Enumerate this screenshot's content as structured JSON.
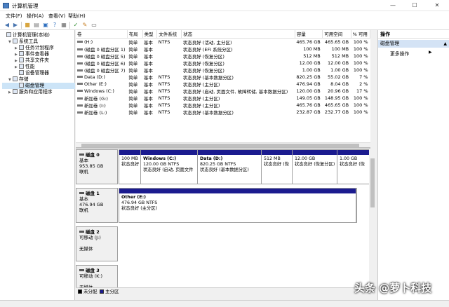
{
  "window": {
    "title": "计算机管理",
    "buttons": {
      "minimize": "—",
      "maximize": "☐",
      "close": "✕"
    }
  },
  "menu": [
    "文件(F)",
    "操作(A)",
    "查看(V)",
    "帮助(H)"
  ],
  "toolbar_icons": [
    "back-arrow-icon",
    "forward-arrow-icon",
    "up-folder-icon",
    "show-tree-icon",
    "properties-icon",
    "help-icon",
    "list-icon",
    "check-icon",
    "export-icon",
    "new-window-icon"
  ],
  "tree": [
    {
      "label": "计算机管理(本地)",
      "depth": 0,
      "expander": "",
      "icon": "computer-icon"
    },
    {
      "label": "系统工具",
      "depth": 1,
      "expander": "▼",
      "icon": "tools-icon"
    },
    {
      "label": "任务计划程序",
      "depth": 2,
      "expander": "▶",
      "icon": "clock-icon"
    },
    {
      "label": "事件查看器",
      "depth": 2,
      "expander": "▶",
      "icon": "event-log-icon"
    },
    {
      "label": "共享文件夹",
      "depth": 2,
      "expander": "▶",
      "icon": "shared-folder-icon"
    },
    {
      "label": "性能",
      "depth": 2,
      "expander": "▶",
      "icon": "performance-icon"
    },
    {
      "label": "设备管理器",
      "depth": 2,
      "expander": "",
      "icon": "device-manager-icon"
    },
    {
      "label": "存储",
      "depth": 1,
      "expander": "▼",
      "icon": "storage-icon"
    },
    {
      "label": "磁盘管理",
      "depth": 2,
      "expander": "",
      "icon": "disk-icon",
      "selected": true
    },
    {
      "label": "服务和应用程序",
      "depth": 1,
      "expander": "▶",
      "icon": "services-icon"
    }
  ],
  "volume_table": {
    "columns": [
      "卷",
      "布局",
      "类型",
      "文件系统",
      "状态",
      "容量",
      "可用空间",
      "% 可用"
    ],
    "rows": [
      [
        "(H:)",
        "简单",
        "基本",
        "NTFS",
        "状态良好 (活动, 主分区)",
        "465.76 GB",
        "465.65 GB",
        "100 %"
      ],
      [
        "(磁盘 0 磁盘分区 1)",
        "简单",
        "基本",
        "",
        "状态良好 (EFI 系统分区)",
        "100 MB",
        "100 MB",
        "100 %"
      ],
      [
        "(磁盘 0 磁盘分区 5)",
        "简单",
        "基本",
        "",
        "状态良好 (恢复分区)",
        "512 MB",
        "512 MB",
        "100 %"
      ],
      [
        "(磁盘 0 磁盘分区 6)",
        "简单",
        "基本",
        "",
        "状态良好 (恢复分区)",
        "12.00 GB",
        "12.00 GB",
        "100 %"
      ],
      [
        "(磁盘 0 磁盘分区 7)",
        "简单",
        "基本",
        "",
        "状态良好 (恢复分区)",
        "1.00 GB",
        "1.00 GB",
        "100 %"
      ],
      [
        "Data (D:)",
        "简单",
        "基本",
        "NTFS",
        "状态良好 (基本数据分区)",
        "820.25 GB",
        "55.02 GB",
        "7 %"
      ],
      [
        "Other (E:)",
        "简单",
        "基本",
        "NTFS",
        "状态良好 (主分区)",
        "476.94 GB",
        "8.04 GB",
        "2 %"
      ],
      [
        "Windows (C:)",
        "简单",
        "基本",
        "NTFS",
        "状态良好 (启动, 页面文件, 故障转储, 基本数据分区)",
        "120.00 GB",
        "20.96 GB",
        "17 %"
      ],
      [
        "新加卷 (G:)",
        "简单",
        "基本",
        "NTFS",
        "状态良好 (主分区)",
        "149.05 GB",
        "148.95 GB",
        "100 %"
      ],
      [
        "新加卷 (I:)",
        "简单",
        "基本",
        "NTFS",
        "状态良好 (主分区)",
        "465.76 GB",
        "465.65 GB",
        "100 %"
      ],
      [
        "新加卷 (L:)",
        "简单",
        "基本",
        "NTFS",
        "状态良好 (基本数据分区)",
        "232.87 GB",
        "232.77 GB",
        "100 %"
      ]
    ]
  },
  "disks": [
    {
      "name": "磁盘 0",
      "lines": [
        "基本",
        "953.85 GB",
        "联机"
      ],
      "partitions": [
        {
          "title": "",
          "lines": [
            "100 MB",
            "状态良好"
          ]
        },
        {
          "title": "Windows (C:)",
          "lines": [
            "120.00 GB NTFS",
            "状态良好 (启动, 页面文件"
          ]
        },
        {
          "title": "Data (D:)",
          "lines": [
            "820.25 GB NTFS",
            "状态良好 (基本数据分区)"
          ]
        },
        {
          "title": "",
          "lines": [
            "512 MB",
            "状态良好 (恢"
          ]
        },
        {
          "title": "",
          "lines": [
            "12.00 GB",
            "状态良好 (恢复分区)"
          ]
        },
        {
          "title": "",
          "lines": [
            "1.00 GB",
            "状态良好 (恢"
          ]
        }
      ]
    },
    {
      "name": "磁盘 1",
      "lines": [
        "基本",
        "476.94 GB",
        "联机"
      ],
      "partitions": [
        {
          "title": "Other (E:)",
          "lines": [
            "476.94 GB NTFS",
            "状态良好 (主分区)"
          ]
        }
      ]
    },
    {
      "name": "磁盘 2",
      "lines": [
        "可移动 (J:)",
        "",
        "无媒体"
      ],
      "partitions": []
    },
    {
      "name": "磁盘 3",
      "lines": [
        "可移动 (K:)",
        "",
        "无媒体"
      ],
      "partitions": []
    }
  ],
  "legend": [
    {
      "label": "未分配",
      "color": "#000000"
    },
    {
      "label": "主分区",
      "color": "#1b1b8f"
    }
  ],
  "actions": {
    "header": "操作",
    "selected": "磁盘管理",
    "more": "更多操作"
  },
  "watermark": "头条 @萝卜科技"
}
